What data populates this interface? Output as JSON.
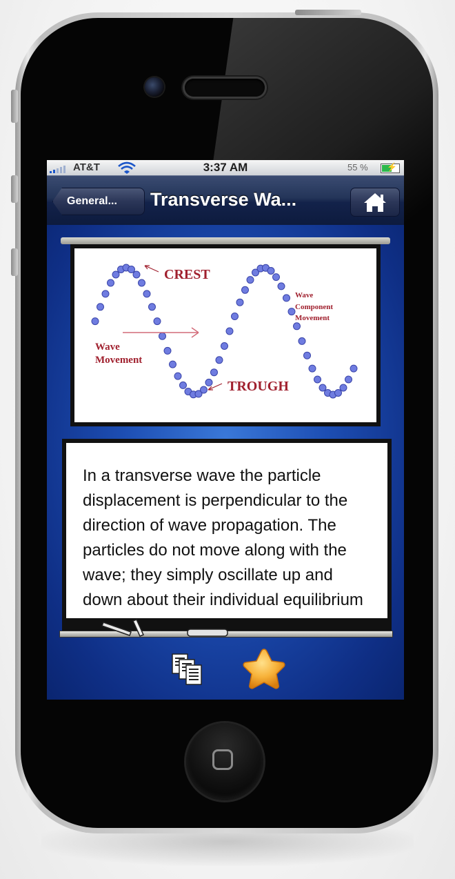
{
  "status_bar": {
    "carrier": "AT&T",
    "time": "3:37 AM",
    "battery_percent": "55 %"
  },
  "nav_bar": {
    "back_label": "General...",
    "title": "Transverse Wa..."
  },
  "diagram": {
    "crest_label": "CREST",
    "trough_label": "TROUGH",
    "wave_movement_line1": "Wave",
    "wave_movement_line2": "Movement",
    "component_line1": "Wave",
    "component_line2": "Component",
    "component_line3": "Movement"
  },
  "description": {
    "text": "In a transverse wave the particle displacement is perpendicular to the direction of wave propagation. The particles do not move along with the wave; they simply oscillate up and down about their individual equilibrium"
  },
  "toolbar": {
    "pages_icon": "pages-icon",
    "favorite_icon": "star-icon"
  },
  "colors": {
    "nav_bar": "#1b2a50",
    "screen_background": "#1d4eb3",
    "diagram_label": "#a0202e",
    "wave_beads": "#6f7ce0",
    "star": "#f5a623"
  }
}
